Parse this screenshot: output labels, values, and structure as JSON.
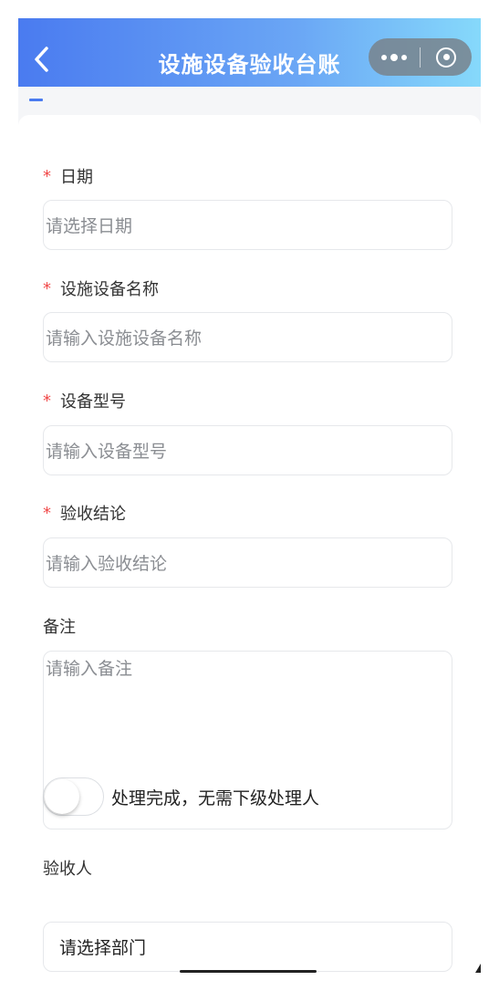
{
  "navbar": {
    "title": "设施设备验收台账",
    "back_icon": "chevron-left-icon",
    "more_icon": "more-dots-icon",
    "close_icon": "target-close-icon"
  },
  "form": {
    "date": {
      "label": "日期",
      "required": true,
      "placeholder": "请选择日期"
    },
    "equipment_name": {
      "label": "设施设备名称",
      "required": true,
      "placeholder": "请输入设施设备名称"
    },
    "model": {
      "label": "设备型号",
      "required": true,
      "placeholder": "请输入设备型号"
    },
    "conclusion": {
      "label": "验收结论",
      "required": true,
      "placeholder": "请输入验收结论"
    },
    "remarks": {
      "label": "备注",
      "required": false,
      "placeholder": "请输入备注"
    },
    "acceptor": {
      "label": "验收人",
      "toggle_label": "处理完成，无需下级处理人",
      "toggle_on": false,
      "department_value": "请选择部门"
    }
  },
  "required_mark": "*",
  "colors": {
    "accent": "#4a7bf0",
    "required": "#f04848",
    "navbar_end": "#86d9fb"
  }
}
